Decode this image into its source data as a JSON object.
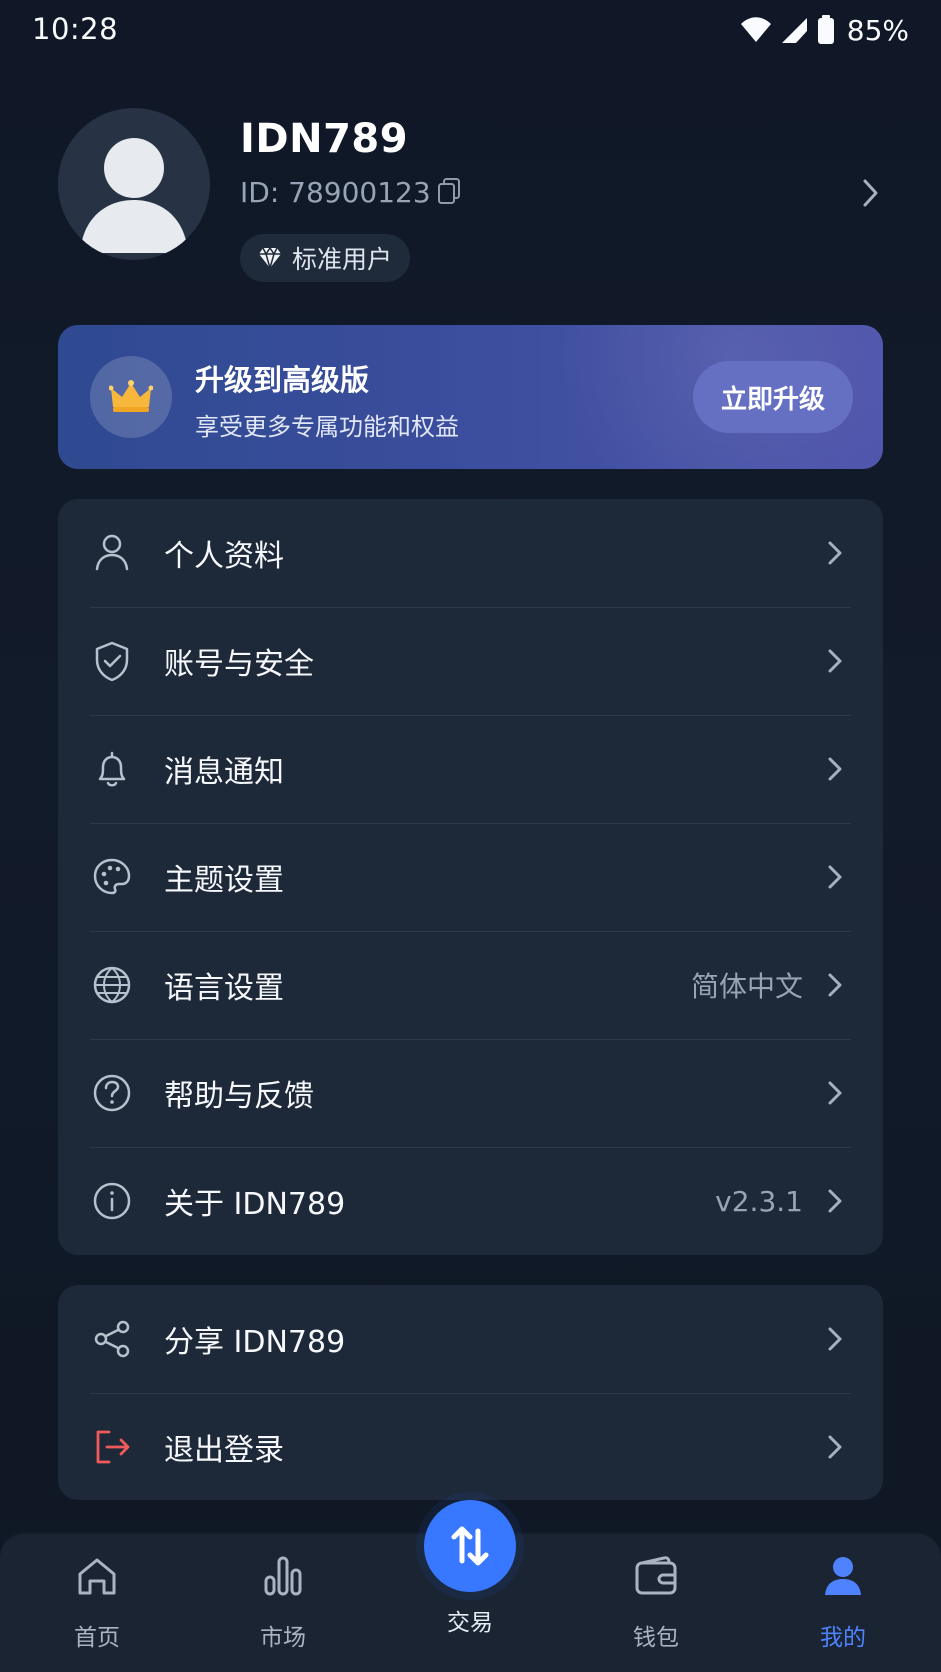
{
  "status_bar": {
    "time": "10:28",
    "battery": "85%",
    "icons": [
      "wifi-icon",
      "signal-icon",
      "battery-icon"
    ]
  },
  "profile": {
    "username": "IDN789",
    "user_id": "ID: 78900123",
    "badge": "标准用户"
  },
  "upgrade": {
    "title": "升级到高级版",
    "subtitle": "享受更多专属功能和权益",
    "button": "立即升级"
  },
  "menu": {
    "items": [
      {
        "label": "个人资料",
        "value": "",
        "icon": "user-icon"
      },
      {
        "label": "账号与安全",
        "value": "",
        "icon": "shield-check-icon"
      },
      {
        "label": "消息通知",
        "value": "",
        "icon": "bell-icon"
      },
      {
        "label": "主题设置",
        "value": "",
        "icon": "palette-icon"
      },
      {
        "label": "语言设置",
        "value": "简体中文",
        "icon": "globe-icon"
      },
      {
        "label": "帮助与反馈",
        "value": "",
        "icon": "help-circle-icon"
      },
      {
        "label": "关于 IDN789",
        "value": "v2.3.1",
        "icon": "info-icon"
      }
    ],
    "secondary": [
      {
        "label": "分享 IDN789",
        "icon": "share-icon"
      },
      {
        "label": "退出登录",
        "icon": "logout-icon"
      }
    ]
  },
  "bottom_nav": {
    "items": [
      {
        "label": "首页",
        "icon": "home-icon",
        "active": false
      },
      {
        "label": "市场",
        "icon": "bar-chart-icon",
        "active": false
      },
      {
        "label": "交易",
        "icon": "swap-vertical-icon",
        "active": false
      },
      {
        "label": "钱包",
        "icon": "wallet-icon",
        "active": false
      },
      {
        "label": "我的",
        "icon": "user-filled-icon",
        "active": true
      }
    ]
  },
  "colors": {
    "background": "#111827",
    "card": "#1d2839",
    "accent": "#3877ff",
    "active_nav": "#4f82ff",
    "logout": "#f05a5a",
    "crown": "#f7b73d"
  }
}
